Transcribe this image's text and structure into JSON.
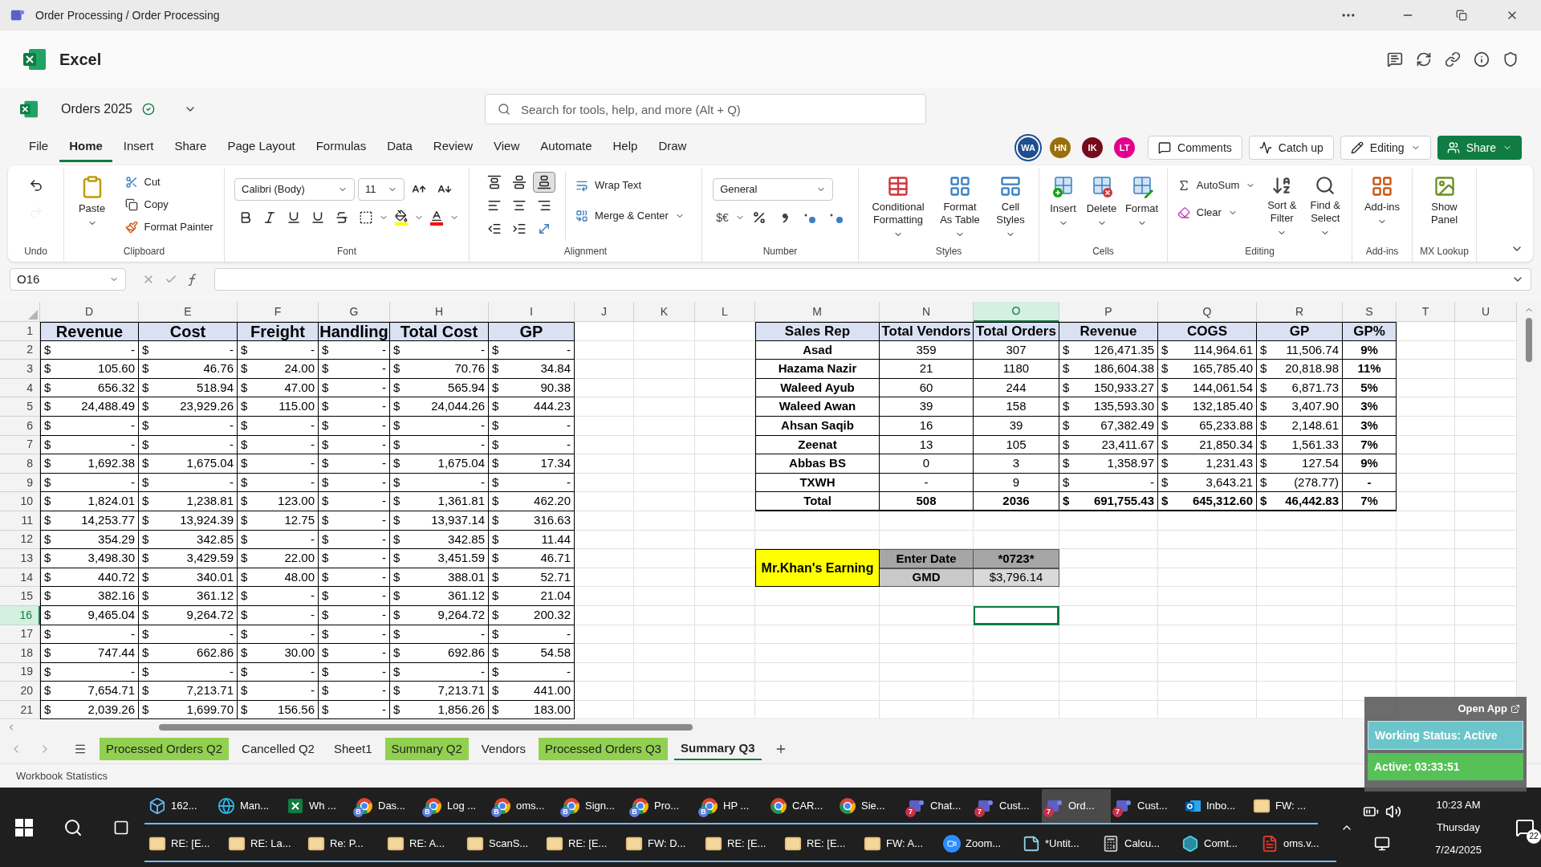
{
  "window": {
    "title": "Order Processing / Order Processing"
  },
  "app": {
    "name": "Excel"
  },
  "document": {
    "name": "Orders 2025"
  },
  "search": {
    "placeholder": "Search for tools, help, and more (Alt + Q)"
  },
  "menu": [
    {
      "label": "File",
      "selected": false
    },
    {
      "label": "Home",
      "selected": true
    },
    {
      "label": "Insert",
      "selected": false
    },
    {
      "label": "Share",
      "selected": false
    },
    {
      "label": "Page Layout",
      "selected": false
    },
    {
      "label": "Formulas",
      "selected": false
    },
    {
      "label": "Data",
      "selected": false
    },
    {
      "label": "Review",
      "selected": false
    },
    {
      "label": "View",
      "selected": false
    },
    {
      "label": "Automate",
      "selected": false
    },
    {
      "label": "Help",
      "selected": false
    },
    {
      "label": "Draw",
      "selected": false
    }
  ],
  "collaborators": [
    {
      "initials": "WA",
      "color": "#1d4f91"
    },
    {
      "initials": "HN",
      "color": "#986f0b"
    },
    {
      "initials": "IK",
      "color": "#750b1c"
    },
    {
      "initials": "LT",
      "color": "#e3008c"
    }
  ],
  "actions": [
    {
      "label": "Comments",
      "kind": "comments"
    },
    {
      "label": "Catch up",
      "kind": "catchup"
    },
    {
      "label": "Editing",
      "kind": "mode"
    },
    {
      "label": "Share",
      "kind": "share"
    }
  ],
  "ribbon": {
    "groups": [
      {
        "label": "Undo",
        "items": [
          {
            "kind": "icon",
            "disabled": false
          },
          {
            "kind": "icon",
            "disabled": true
          }
        ]
      },
      {
        "label": "Clipboard",
        "items": [
          {
            "label": "Paste",
            "kind": "large"
          },
          {
            "label": "Cut",
            "kind": "small"
          },
          {
            "label": "Copy",
            "kind": "small"
          },
          {
            "label": "Format Painter",
            "kind": "small"
          }
        ]
      },
      {
        "label": "Font",
        "items": [
          {
            "kind": "field",
            "value": "Calibri (Body)"
          },
          {
            "kind": "field",
            "value": "11"
          },
          {
            "kind": "icon"
          },
          {
            "kind": "icon"
          },
          {
            "kind": "icon"
          },
          {
            "kind": "icon"
          },
          {
            "kind": "icon"
          },
          {
            "kind": "icon"
          },
          {
            "kind": "icon"
          },
          {
            "kind": "icon"
          },
          {
            "kind": "icon",
            "color": "#ffff00"
          },
          {
            "kind": "icon",
            "color": "#ff0000"
          }
        ]
      },
      {
        "label": "Alignment",
        "items": [
          {
            "kind": "icon",
            "selected": false
          },
          {
            "kind": "icon",
            "selected": false
          },
          {
            "kind": "icon",
            "selected": true
          },
          {
            "kind": "icon"
          },
          {
            "kind": "icon"
          },
          {
            "kind": "icon"
          },
          {
            "kind": "icon"
          },
          {
            "kind": "icon"
          },
          {
            "kind": "icon"
          },
          {
            "label": "Wrap Text",
            "kind": "small"
          },
          {
            "label": "Merge & Center",
            "kind": "small"
          }
        ]
      },
      {
        "label": "Number",
        "items": [
          {
            "kind": "field",
            "value": "General"
          },
          {
            "label": "$€",
            "kind": "text"
          },
          {
            "kind": "icon"
          },
          {
            "kind": "icon"
          },
          {
            "kind": "icon"
          },
          {
            "kind": "icon"
          }
        ]
      },
      {
        "label": "Styles",
        "items": [
          {
            "label": "Conditional Formatting",
            "kind": "large"
          },
          {
            "label": "Format As Table",
            "kind": "large"
          },
          {
            "label": "Cell Styles",
            "kind": "large"
          }
        ]
      },
      {
        "label": "Cells",
        "items": [
          {
            "label": "Insert",
            "kind": "large"
          },
          {
            "label": "Delete",
            "kind": "large"
          },
          {
            "label": "Format",
            "kind": "large"
          }
        ]
      },
      {
        "label": "Editing",
        "items": [
          {
            "label": "AutoSum",
            "kind": "small"
          },
          {
            "label": "Clear",
            "kind": "small"
          },
          {
            "label": "Sort & Filter",
            "kind": "large"
          },
          {
            "label": "Find & Select",
            "kind": "large"
          }
        ]
      },
      {
        "label": "Add-ins",
        "items": [
          {
            "label": "Add-ins",
            "kind": "large"
          }
        ]
      },
      {
        "label": "MX Lookup",
        "items": [
          {
            "label": "Show Panel",
            "kind": "large"
          }
        ]
      }
    ]
  },
  "formula_bar": {
    "name_box": "O16"
  },
  "column_headers": [
    {
      "label": "D",
      "selected": false
    },
    {
      "label": "E",
      "selected": false
    },
    {
      "label": "F",
      "selected": false
    },
    {
      "label": "G",
      "selected": false
    },
    {
      "label": "H",
      "selected": false
    },
    {
      "label": "I",
      "selected": false
    },
    {
      "label": "J",
      "selected": false
    },
    {
      "label": "K",
      "selected": false
    },
    {
      "label": "L",
      "selected": false
    },
    {
      "label": "M",
      "selected": false
    },
    {
      "label": "N",
      "selected": false
    },
    {
      "label": "O",
      "selected": true
    },
    {
      "label": "P",
      "selected": false
    },
    {
      "label": "Q",
      "selected": false
    },
    {
      "label": "R",
      "selected": false
    },
    {
      "label": "S",
      "selected": false
    },
    {
      "label": "T",
      "selected": false
    },
    {
      "label": "U",
      "selected": false
    }
  ],
  "row_headers": [
    {
      "label": "1",
      "selected": false
    },
    {
      "label": "2",
      "selected": false
    },
    {
      "label": "3",
      "selected": false
    },
    {
      "label": "4",
      "selected": false
    },
    {
      "label": "5",
      "selected": false
    },
    {
      "label": "6",
      "selected": false
    },
    {
      "label": "7",
      "selected": false
    },
    {
      "label": "8",
      "selected": false
    },
    {
      "label": "9",
      "selected": false
    },
    {
      "label": "10",
      "selected": false
    },
    {
      "label": "11",
      "selected": false
    },
    {
      "label": "12",
      "selected": false
    },
    {
      "label": "13",
      "selected": false
    },
    {
      "label": "14",
      "selected": false
    },
    {
      "label": "15",
      "selected": false
    },
    {
      "label": "16",
      "selected": true
    },
    {
      "label": "17",
      "selected": false
    },
    {
      "label": "18",
      "selected": false
    },
    {
      "label": "19",
      "selected": false
    },
    {
      "label": "20",
      "selected": false
    },
    {
      "label": "21",
      "selected": false
    }
  ],
  "cost_table": {
    "columns": [
      "Revenue",
      "Cost",
      "Freight",
      "Handling",
      "Total Cost",
      "GP"
    ],
    "rows": [
      [
        [
          "$",
          "-"
        ],
        [
          "$",
          "-"
        ],
        [
          "$",
          "-"
        ],
        [
          "$",
          "-"
        ],
        [
          "$",
          "-"
        ],
        [
          "$",
          "-"
        ]
      ],
      [
        [
          "$",
          "105.60"
        ],
        [
          "$",
          "46.76"
        ],
        [
          "$",
          "24.00"
        ],
        [
          "$",
          "-"
        ],
        [
          "$",
          "70.76"
        ],
        [
          "$",
          "34.84"
        ]
      ],
      [
        [
          "$",
          "656.32"
        ],
        [
          "$",
          "518.94"
        ],
        [
          "$",
          "47.00"
        ],
        [
          "$",
          "-"
        ],
        [
          "$",
          "565.94"
        ],
        [
          "$",
          "90.38"
        ]
      ],
      [
        [
          "$",
          "24,488.49"
        ],
        [
          "$",
          "23,929.26"
        ],
        [
          "$",
          "115.00"
        ],
        [
          "$",
          "-"
        ],
        [
          "$",
          "24,044.26"
        ],
        [
          "$",
          "444.23"
        ]
      ],
      [
        [
          "$",
          "-"
        ],
        [
          "$",
          "-"
        ],
        [
          "$",
          "-"
        ],
        [
          "$",
          "-"
        ],
        [
          "$",
          "-"
        ],
        [
          "$",
          "-"
        ]
      ],
      [
        [
          "$",
          "-"
        ],
        [
          "$",
          "-"
        ],
        [
          "$",
          "-"
        ],
        [
          "$",
          "-"
        ],
        [
          "$",
          "-"
        ],
        [
          "$",
          "-"
        ]
      ],
      [
        [
          "$",
          "1,692.38"
        ],
        [
          "$",
          "1,675.04"
        ],
        [
          "$",
          "-"
        ],
        [
          "$",
          "-"
        ],
        [
          "$",
          "1,675.04"
        ],
        [
          "$",
          "17.34"
        ]
      ],
      [
        [
          "$",
          "-"
        ],
        [
          "$",
          "-"
        ],
        [
          "$",
          "-"
        ],
        [
          "$",
          "-"
        ],
        [
          "$",
          "-"
        ],
        [
          "$",
          "-"
        ]
      ],
      [
        [
          "$",
          "1,824.01"
        ],
        [
          "$",
          "1,238.81"
        ],
        [
          "$",
          "123.00"
        ],
        [
          "$",
          "-"
        ],
        [
          "$",
          "1,361.81"
        ],
        [
          "$",
          "462.20"
        ]
      ],
      [
        [
          "$",
          "14,253.77"
        ],
        [
          "$",
          "13,924.39"
        ],
        [
          "$",
          "12.75"
        ],
        [
          "$",
          "-"
        ],
        [
          "$",
          "13,937.14"
        ],
        [
          "$",
          "316.63"
        ]
      ],
      [
        [
          "$",
          "354.29"
        ],
        [
          "$",
          "342.85"
        ],
        [
          "$",
          "-"
        ],
        [
          "$",
          "-"
        ],
        [
          "$",
          "342.85"
        ],
        [
          "$",
          "11.44"
        ]
      ],
      [
        [
          "$",
          "3,498.30"
        ],
        [
          "$",
          "3,429.59"
        ],
        [
          "$",
          "22.00"
        ],
        [
          "$",
          "-"
        ],
        [
          "$",
          "3,451.59"
        ],
        [
          "$",
          "46.71"
        ]
      ],
      [
        [
          "$",
          "440.72"
        ],
        [
          "$",
          "340.01"
        ],
        [
          "$",
          "48.00"
        ],
        [
          "$",
          "-"
        ],
        [
          "$",
          "388.01"
        ],
        [
          "$",
          "52.71"
        ]
      ],
      [
        [
          "$",
          "382.16"
        ],
        [
          "$",
          "361.12"
        ],
        [
          "$",
          "-"
        ],
        [
          "$",
          "-"
        ],
        [
          "$",
          "361.12"
        ],
        [
          "$",
          "21.04"
        ]
      ],
      [
        [
          "$",
          "9,465.04"
        ],
        [
          "$",
          "9,264.72"
        ],
        [
          "$",
          "-"
        ],
        [
          "$",
          "-"
        ],
        [
          "$",
          "9,264.72"
        ],
        [
          "$",
          "200.32"
        ]
      ],
      [
        [
          "$",
          "-"
        ],
        [
          "$",
          "-"
        ],
        [
          "$",
          "-"
        ],
        [
          "$",
          "-"
        ],
        [
          "$",
          "-"
        ],
        [
          "$",
          "-"
        ]
      ],
      [
        [
          "$",
          "747.44"
        ],
        [
          "$",
          "662.86"
        ],
        [
          "$",
          "30.00"
        ],
        [
          "$",
          "-"
        ],
        [
          "$",
          "692.86"
        ],
        [
          "$",
          "54.58"
        ]
      ],
      [
        [
          "$",
          "-"
        ],
        [
          "$",
          "-"
        ],
        [
          "$",
          "-"
        ],
        [
          "$",
          "-"
        ],
        [
          "$",
          "-"
        ],
        [
          "$",
          "-"
        ]
      ],
      [
        [
          "$",
          "7,654.71"
        ],
        [
          "$",
          "7,213.71"
        ],
        [
          "$",
          "-"
        ],
        [
          "$",
          "-"
        ],
        [
          "$",
          "7,213.71"
        ],
        [
          "$",
          "441.00"
        ]
      ],
      [
        [
          "$",
          "2,039.26"
        ],
        [
          "$",
          "1,699.70"
        ],
        [
          "$",
          "156.56"
        ],
        [
          "$",
          "-"
        ],
        [
          "$",
          "1,856.26"
        ],
        [
          "$",
          "183.00"
        ]
      ]
    ]
  },
  "sales_table": {
    "columns": [
      "Sales Rep",
      "Total Vendors",
      "Total Orders",
      "Revenue",
      "COGS",
      "GP",
      "GP%"
    ],
    "rows": [
      {
        "kind": "data",
        "cells": [
          "Asad",
          "359",
          "307",
          [
            "$",
            "126,471.35"
          ],
          [
            "$",
            "114,964.61"
          ],
          [
            "$",
            "11,506.74"
          ],
          "9%"
        ]
      },
      {
        "kind": "data",
        "cells": [
          "Hazama Nazir",
          "21",
          "1180",
          [
            "$",
            "186,604.38"
          ],
          [
            "$",
            "165,785.40"
          ],
          [
            "$",
            "20,818.98"
          ],
          "11%"
        ]
      },
      {
        "kind": "data",
        "cells": [
          "Waleed Ayub",
          "60",
          "244",
          [
            "$",
            "150,933.27"
          ],
          [
            "$",
            "144,061.54"
          ],
          [
            "$",
            "6,871.73"
          ],
          "5%"
        ]
      },
      {
        "kind": "data",
        "cells": [
          "Waleed Awan",
          "39",
          "158",
          [
            "$",
            "135,593.30"
          ],
          [
            "$",
            "132,185.40"
          ],
          [
            "$",
            "3,407.90"
          ],
          "3%"
        ]
      },
      {
        "kind": "data",
        "cells": [
          "Ahsan Saqib",
          "16",
          "39",
          [
            "$",
            "67,382.49"
          ],
          [
            "$",
            "65,233.88"
          ],
          [
            "$",
            "2,148.61"
          ],
          "3%"
        ]
      },
      {
        "kind": "data",
        "cells": [
          "Zeenat",
          "13",
          "105",
          [
            "$",
            "23,411.67"
          ],
          [
            "$",
            "21,850.34"
          ],
          [
            "$",
            "1,561.33"
          ],
          "7%"
        ]
      },
      {
        "kind": "data",
        "cells": [
          "Abbas BS",
          "0",
          "3",
          [
            "$",
            "1,358.97"
          ],
          [
            "$",
            "1,231.43"
          ],
          [
            "$",
            "127.54"
          ],
          "9%"
        ]
      },
      {
        "kind": "data",
        "cells": [
          "TXWH",
          "-",
          "9",
          [
            "$",
            "-"
          ],
          [
            "$",
            "3,643.21"
          ],
          [
            "$",
            "(278.77)"
          ],
          "-"
        ]
      },
      {
        "kind": "total",
        "cells": [
          "Total",
          "508",
          "2036",
          [
            "$",
            "691,755.43"
          ],
          [
            "$",
            "645,312.60"
          ],
          [
            "$",
            "46,442.83"
          ],
          "7%"
        ]
      }
    ]
  },
  "earning": {
    "label": "Mr.Khan's Earning",
    "fields": [
      {
        "label": "Enter Date",
        "value": "*0723*"
      },
      {
        "label": "GMD",
        "value": "$3,796.14"
      }
    ]
  },
  "sheet_tabs": [
    {
      "label": "Processed Orders Q2",
      "selected": false,
      "color": "#92d050"
    },
    {
      "label": "Cancelled Q2",
      "selected": false
    },
    {
      "label": "Sheet1",
      "selected": false
    },
    {
      "label": "Summary Q2",
      "selected": false,
      "color": "#92d050"
    },
    {
      "label": "Vendors",
      "selected": false
    },
    {
      "label": "Processed Orders Q3",
      "selected": false,
      "color": "#92d050"
    },
    {
      "label": "Summary Q3",
      "selected": true
    }
  ],
  "status_bar": {
    "text": "Workbook Statistics"
  },
  "overlay": {
    "link": "Open App",
    "status": "Working Status: Active",
    "timer": "Active: 03:33:51"
  },
  "taskbar": {
    "row_1": [
      {
        "label": "162...",
        "kind": "cube",
        "selected": false
      },
      {
        "label": "Man...",
        "kind": "edge",
        "selected": false
      },
      {
        "label": "Wh ...",
        "kind": "excel",
        "selected": false
      },
      {
        "label": "Das...",
        "kind": "chrome",
        "badge": "B",
        "selected": false
      },
      {
        "label": "Log ...",
        "kind": "chrome",
        "badge": "B",
        "selected": false
      },
      {
        "label": "oms...",
        "kind": "chrome",
        "badge": "B",
        "selected": false
      },
      {
        "label": "Sign...",
        "kind": "chrome",
        "badge": "B",
        "selected": false
      },
      {
        "label": "Pro...",
        "kind": "chrome",
        "badge": "B",
        "selected": false
      },
      {
        "label": "HP ...",
        "kind": "chrome",
        "badge": "B",
        "selected": false
      },
      {
        "label": "CAR...",
        "kind": "chrome",
        "selected": false
      },
      {
        "label": "Sie...",
        "kind": "chrome",
        "selected": false
      },
      {
        "label": "Chat...",
        "kind": "teams",
        "badge": "7",
        "selected": false
      },
      {
        "label": "Cust...",
        "kind": "teams",
        "badge": "7",
        "selected": false
      },
      {
        "label": "Ord...",
        "kind": "teams",
        "badge": "7",
        "selected": true
      },
      {
        "label": "Cust...",
        "kind": "teams",
        "badge": "7",
        "selected": false
      },
      {
        "label": "Inbo...",
        "kind": "outlook",
        "selected": false
      },
      {
        "label": "FW: ...",
        "kind": "mail",
        "selected": false
      }
    ],
    "row_2": [
      {
        "label": "RE: [E...",
        "kind": "mail",
        "selected": false
      },
      {
        "label": "RE: La...",
        "kind": "mail",
        "selected": false
      },
      {
        "label": "Re: P...",
        "kind": "mail",
        "selected": false
      },
      {
        "label": "RE: A...",
        "kind": "mail",
        "selected": false
      },
      {
        "label": "ScanS...",
        "kind": "mail",
        "selected": false
      },
      {
        "label": "RE: [E...",
        "kind": "mail",
        "selected": false
      },
      {
        "label": "FW: D...",
        "kind": "mail",
        "selected": false
      },
      {
        "label": "RE: [E...",
        "kind": "mail",
        "selected": false
      },
      {
        "label": "RE: [E...",
        "kind": "mail",
        "selected": false
      },
      {
        "label": "FW: A...",
        "kind": "mail",
        "selected": false
      },
      {
        "label": "Zoom...",
        "kind": "zoom",
        "selected": false
      },
      {
        "label": "*Untit...",
        "kind": "notepad",
        "selected": false
      },
      {
        "label": "Calcu...",
        "kind": "calculator",
        "selected": false
      },
      {
        "label": "Comt...",
        "kind": "app",
        "selected": false
      },
      {
        "label": "oms.v...",
        "kind": "pdf",
        "selected": false
      }
    ],
    "tray": {
      "time": "10:23 AM",
      "day": "Thursday",
      "date": "7/24/2025",
      "notifications": "22"
    }
  }
}
